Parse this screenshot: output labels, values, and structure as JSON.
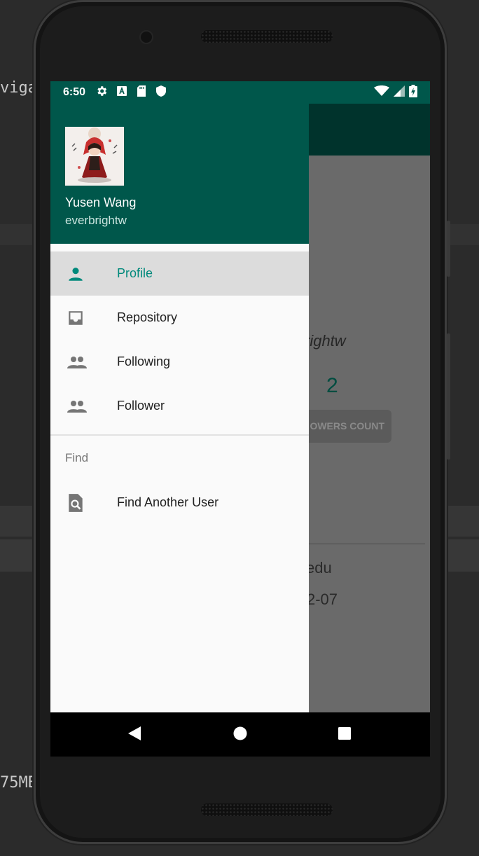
{
  "ide": {
    "top_fragment": "viga",
    "bottom_fragment": "75MB"
  },
  "status_bar": {
    "time": "6:50",
    "icons": [
      "settings-icon",
      "a-icon",
      "sd-card-icon",
      "shield-icon"
    ],
    "right_icons": [
      "wifi-icon",
      "signal-icon",
      "battery-icon"
    ]
  },
  "drawer": {
    "header": {
      "name": "Yusen Wang",
      "login": "everbrightw"
    },
    "items": [
      {
        "label": "Profile",
        "icon": "person-icon",
        "active": true
      },
      {
        "label": "Repository",
        "icon": "inbox-icon",
        "active": false
      },
      {
        "label": "Following",
        "icon": "people-icon",
        "active": false
      },
      {
        "label": "Follower",
        "icon": "people-icon",
        "active": false
      }
    ],
    "section_title": "Find",
    "find_item": {
      "label": "Find Another User",
      "icon": "find-in-page-icon"
    }
  },
  "background_app": {
    "login_fragment": "rightw",
    "count": "2",
    "button_fragment": "OWERS COUNT",
    "email_fragment": "edu",
    "date_fragment": "2-07"
  },
  "navigation": [
    "back-icon",
    "home-icon",
    "recents-icon"
  ],
  "colors": {
    "primary_dark": "#00574b",
    "accent": "#00897b",
    "toolbar_dimmed": "#00332c"
  }
}
